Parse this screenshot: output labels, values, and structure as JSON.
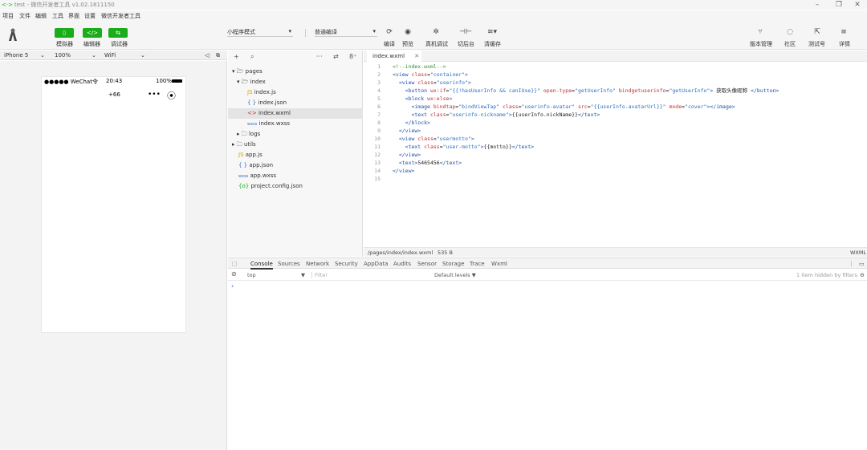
{
  "window": {
    "title": "test - 微信开发者工具 v1.02.1811150",
    "minimize": "–",
    "maximize": "❐",
    "close": "✕"
  },
  "menu": [
    "项目",
    "文件",
    "编辑",
    "工具",
    "界面",
    "设置",
    "微信开发者工具"
  ],
  "toolbar": {
    "simulator_label": "模拟器",
    "editor_label": "编辑器",
    "debugger_label": "调试器",
    "mode_select": "小程序模式",
    "compile_select": "普通编译",
    "compile_label": "编译",
    "preview_label": "预览",
    "remote_debug_label": "真机调试",
    "background_label": "切后台",
    "clear_cache_label": "清缓存",
    "version_label": "版本管理",
    "community_label": "社区",
    "test_label": "测试号",
    "details_label": "详情"
  },
  "device_bar": {
    "device": "iPhone 5",
    "zoom": "100%",
    "network": "WiFi"
  },
  "phone": {
    "carrier": "●●●●● WeChat令",
    "time": "20:43",
    "battery": "100%",
    "nav_text": "+66",
    "dots": "•••",
    "record": "⦿"
  },
  "explorer": {
    "add": "+",
    "search": "⌕",
    "more": "···",
    "collapse": "⇄",
    "ops": "8⁺",
    "items": [
      {
        "icon": "▾ 🗁",
        "label": "pages"
      },
      {
        "icon": "▾ 🗁",
        "label": "index"
      },
      {
        "icon": "JS",
        "label": "index.js"
      },
      {
        "icon": "{ }",
        "label": "index.json"
      },
      {
        "icon": "<>",
        "label": "index.wxml"
      },
      {
        "icon": "wxss",
        "label": "index.wxss"
      },
      {
        "icon": "▸ 🗀",
        "label": "logs"
      },
      {
        "icon": "▸ 🗀",
        "label": "utils"
      },
      {
        "icon": "JS",
        "label": "app.js"
      },
      {
        "icon": "{ }",
        "label": "app.json"
      },
      {
        "icon": "wxss",
        "label": "app.wxss"
      },
      {
        "icon": "{o}",
        "label": "project.config.json"
      }
    ]
  },
  "editor": {
    "tab_label": "index.wxml",
    "tab_close": "✕",
    "line_numbers": [
      "1",
      "2",
      "3",
      "4",
      "5",
      "6",
      "7",
      "8",
      "9",
      "10",
      "11",
      "12",
      "13",
      "14",
      "15"
    ],
    "status_path": "/pages/index/index.wxml",
    "status_size": "535 B",
    "status_lang": "WXML"
  },
  "devtools": {
    "tabs": [
      "Console",
      "Sources",
      "Network",
      "Security",
      "AppData",
      "Audits",
      "Sensor",
      "Storage",
      "Trace",
      "Wxml"
    ],
    "context": "top",
    "filter_placeholder": "Filter",
    "levels": "Default levels ▼",
    "hidden": "1 item hidden by filters",
    "prompt": "›"
  },
  "colors": {
    "accent": "#1aad19",
    "tag": "#1f4fa8",
    "attribute": "#c03030",
    "value": "#2a6fc0",
    "comment": "#2f8f2f"
  }
}
